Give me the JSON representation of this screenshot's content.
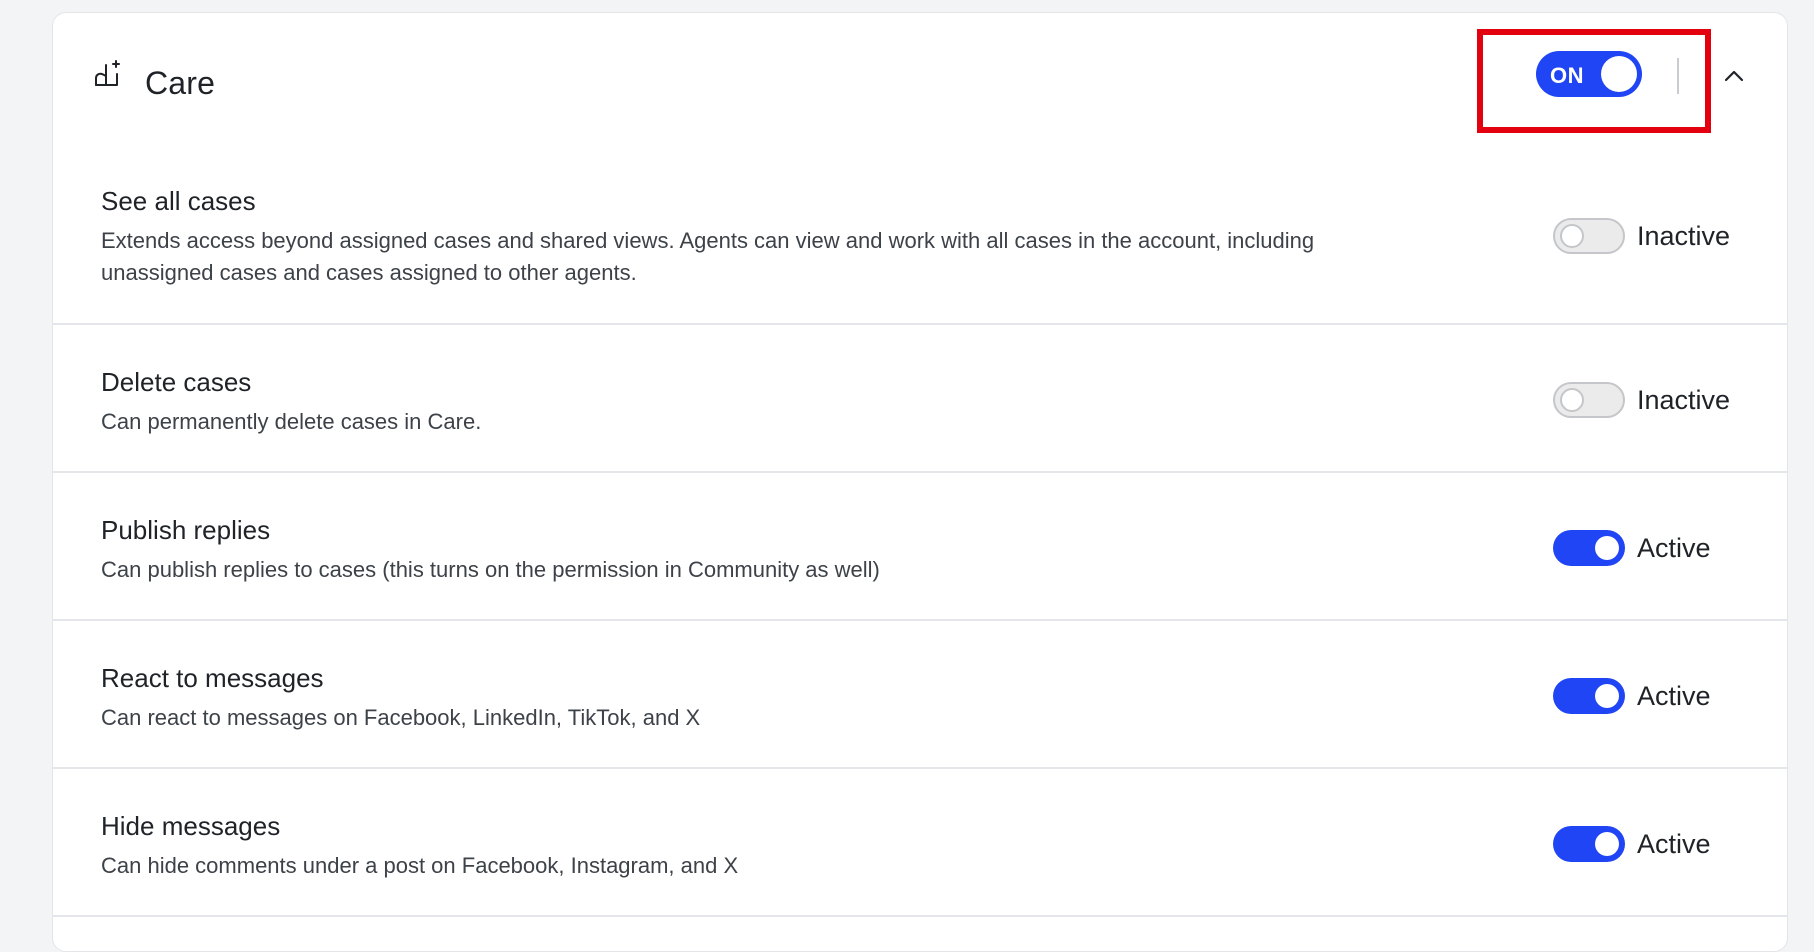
{
  "section": {
    "title": "Care",
    "icon": "hand-care-icon",
    "master_toggle_label": "ON",
    "collapse_icon": "chevron-up-icon"
  },
  "permissions": [
    {
      "title": "See all cases",
      "description_line1": "Extends access beyond assigned cases and shared views. Agents can view and work with all cases in the account, including",
      "description_line2": "unassigned cases and cases assigned to other agents.",
      "status": "Inactive",
      "enabled": false
    },
    {
      "title": "Delete cases",
      "description_line1": "Can permanently delete cases in Care.",
      "status": "Inactive",
      "enabled": false
    },
    {
      "title": "Publish replies",
      "description_line1": "Can publish replies to cases (this turns on the permission in Community as well)",
      "status": "Active",
      "enabled": true
    },
    {
      "title": "React to messages",
      "description_line1": "Can react to messages on Facebook, LinkedIn, TikTok, and X",
      "status": "Active",
      "enabled": true
    },
    {
      "title": "Hide messages",
      "description_line1": "Can hide comments under a post on Facebook, Instagram, and X",
      "status": "Active",
      "enabled": true
    }
  ],
  "colors": {
    "accent": "#2045f4",
    "highlight": "#e3000f",
    "toggle_off": "#ebebeb"
  }
}
